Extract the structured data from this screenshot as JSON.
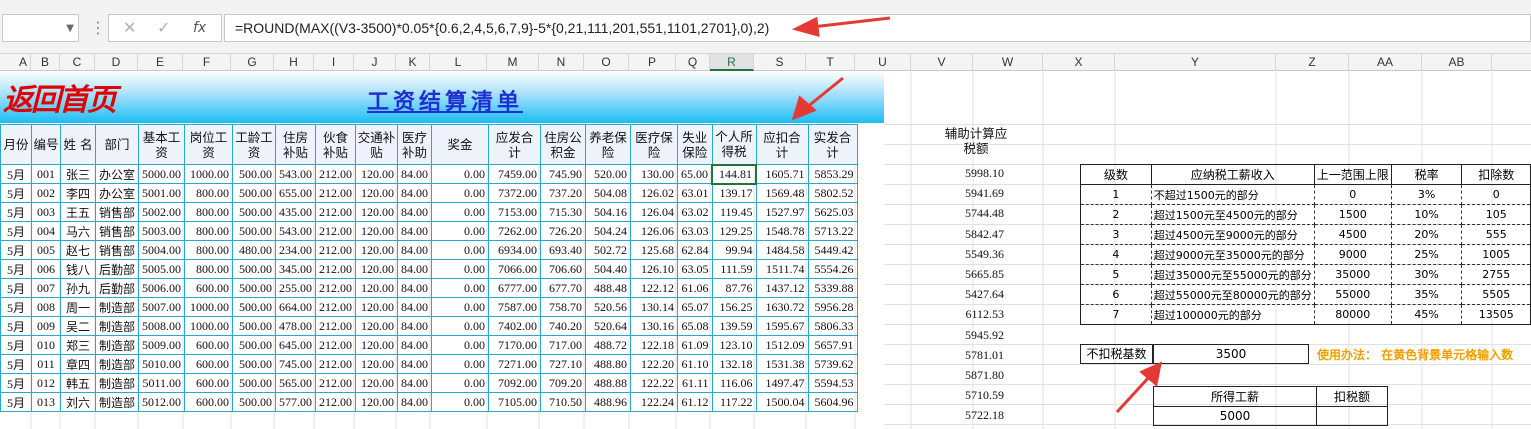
{
  "formula_bar": {
    "cell_ref": "",
    "cancel_icon": "✕",
    "confirm_icon": "✓",
    "fx_label": "fx",
    "formula": "=ROUND(MAX((V3-3500)*0.05*{0.6,2,4,5,6,7,9}-5*{0,21,111,201,551,1101,2701},0),2)"
  },
  "columns": [
    "A",
    "B",
    "C",
    "D",
    "E",
    "F",
    "G",
    "H",
    "I",
    "J",
    "K",
    "L",
    "M",
    "N",
    "O",
    "P",
    "Q",
    "R",
    "S",
    "T",
    "U",
    "V",
    "W",
    "X",
    "Y",
    "Z",
    "AA",
    "AB"
  ],
  "selected_column": "R",
  "banner": {
    "home_link": "返回首页",
    "title": "工资结算清单"
  },
  "table": {
    "headers": [
      "月份",
      "编号",
      "姓 名",
      "部门",
      "基本工资",
      "岗位工资",
      "工龄工资",
      "住房补贴",
      "伙食补贴",
      "交通补贴",
      "医疗补助",
      "奖金",
      "应发合计",
      "住房公积金",
      "养老保险",
      "医疗保险",
      "失业保险",
      "个人所得税",
      "应扣合计",
      "实发合计"
    ],
    "rows": [
      [
        "5月",
        "001",
        "张三",
        "办公室",
        "5000.00",
        "1000.00",
        "500.00",
        "543.00",
        "212.00",
        "120.00",
        "84.00",
        "0.00",
        "7459.00",
        "745.90",
        "520.00",
        "130.00",
        "65.00",
        "144.81",
        "1605.71",
        "5853.29"
      ],
      [
        "5月",
        "002",
        "李四",
        "办公室",
        "5001.00",
        "800.00",
        "500.00",
        "655.00",
        "212.00",
        "120.00",
        "84.00",
        "0.00",
        "7372.00",
        "737.20",
        "504.08",
        "126.02",
        "63.01",
        "139.17",
        "1569.48",
        "5802.52"
      ],
      [
        "5月",
        "003",
        "王五",
        "销售部",
        "5002.00",
        "800.00",
        "500.00",
        "435.00",
        "212.00",
        "120.00",
        "84.00",
        "0.00",
        "7153.00",
        "715.30",
        "504.16",
        "126.04",
        "63.02",
        "119.45",
        "1527.97",
        "5625.03"
      ],
      [
        "5月",
        "004",
        "马六",
        "销售部",
        "5003.00",
        "800.00",
        "500.00",
        "543.00",
        "212.00",
        "120.00",
        "84.00",
        "0.00",
        "7262.00",
        "726.20",
        "504.24",
        "126.06",
        "63.03",
        "129.25",
        "1548.78",
        "5713.22"
      ],
      [
        "5月",
        "005",
        "赵七",
        "销售部",
        "5004.00",
        "800.00",
        "480.00",
        "234.00",
        "212.00",
        "120.00",
        "84.00",
        "0.00",
        "6934.00",
        "693.40",
        "502.72",
        "125.68",
        "62.84",
        "99.94",
        "1484.58",
        "5449.42"
      ],
      [
        "5月",
        "006",
        "钱八",
        "后勤部",
        "5005.00",
        "800.00",
        "500.00",
        "345.00",
        "212.00",
        "120.00",
        "84.00",
        "0.00",
        "7066.00",
        "706.60",
        "504.40",
        "126.10",
        "63.05",
        "111.59",
        "1511.74",
        "5554.26"
      ],
      [
        "5月",
        "007",
        "孙九",
        "后勤部",
        "5006.00",
        "600.00",
        "500.00",
        "255.00",
        "212.00",
        "120.00",
        "84.00",
        "0.00",
        "6777.00",
        "677.70",
        "488.48",
        "122.12",
        "61.06",
        "87.76",
        "1437.12",
        "5339.88"
      ],
      [
        "5月",
        "008",
        "周一",
        "制造部",
        "5007.00",
        "1000.00",
        "500.00",
        "664.00",
        "212.00",
        "120.00",
        "84.00",
        "0.00",
        "7587.00",
        "758.70",
        "520.56",
        "130.14",
        "65.07",
        "156.25",
        "1630.72",
        "5956.28"
      ],
      [
        "5月",
        "009",
        "吴二",
        "制造部",
        "5008.00",
        "1000.00",
        "500.00",
        "478.00",
        "212.00",
        "120.00",
        "84.00",
        "0.00",
        "7402.00",
        "740.20",
        "520.64",
        "130.16",
        "65.08",
        "139.59",
        "1595.67",
        "5806.33"
      ],
      [
        "5月",
        "010",
        "郑三",
        "制造部",
        "5009.00",
        "600.00",
        "500.00",
        "645.00",
        "212.00",
        "120.00",
        "84.00",
        "0.00",
        "7170.00",
        "717.00",
        "488.72",
        "122.18",
        "61.09",
        "123.10",
        "1512.09",
        "5657.91"
      ],
      [
        "5月",
        "011",
        "章四",
        "制造部",
        "5010.00",
        "600.00",
        "500.00",
        "745.00",
        "212.00",
        "120.00",
        "84.00",
        "0.00",
        "7271.00",
        "727.10",
        "488.80",
        "122.20",
        "61.10",
        "132.18",
        "1531.38",
        "5739.62"
      ],
      [
        "5月",
        "012",
        "韩五",
        "制造部",
        "5011.00",
        "600.00",
        "500.00",
        "565.00",
        "212.00",
        "120.00",
        "84.00",
        "0.00",
        "7092.00",
        "709.20",
        "488.88",
        "122.22",
        "61.11",
        "116.06",
        "1497.47",
        "5594.53"
      ],
      [
        "5月",
        "013",
        "刘六",
        "制造部",
        "5012.00",
        "600.00",
        "500.00",
        "577.00",
        "212.00",
        "120.00",
        "84.00",
        "0.00",
        "7105.00",
        "710.50",
        "488.96",
        "122.24",
        "61.12",
        "117.22",
        "1500.04",
        "5604.96"
      ]
    ]
  },
  "aux": {
    "header": "辅助计算应税额",
    "values": [
      "5998.10",
      "5941.69",
      "5744.48",
      "5842.47",
      "5549.36",
      "5665.85",
      "5427.64",
      "6112.53",
      "5945.92",
      "5781.01",
      "5871.80",
      "5710.59",
      "5722.18"
    ]
  },
  "tax_table": {
    "headers": [
      "级数",
      "应纳税工薪收入",
      "上一范围上限",
      "税率",
      "扣除数"
    ],
    "rows": [
      [
        "1",
        "不超过1500元的部分",
        "0",
        "3%",
        "0"
      ],
      [
        "2",
        "超过1500元至4500元的部分",
        "1500",
        "10%",
        "105"
      ],
      [
        "3",
        "超过4500元至9000元的部分",
        "4500",
        "20%",
        "555"
      ],
      [
        "4",
        "超过9000元至35000元的部分",
        "9000",
        "25%",
        "1005"
      ],
      [
        "5",
        "超过35000元至55000元的部分",
        "35000",
        "30%",
        "2755"
      ],
      [
        "6",
        "超过55000元至80000元的部分",
        "55000",
        "35%",
        "5505"
      ],
      [
        "7",
        "超过100000元的部分",
        "80000",
        "45%",
        "13505"
      ]
    ]
  },
  "deduction": {
    "label": "不扣税基数",
    "value": "3500",
    "usage": "使用办法：   在黄色背景单元格输入数"
  },
  "calc": {
    "header_income": "所得工薪",
    "header_tax": "扣税额",
    "income": "5000",
    "tax": ""
  },
  "colors": {
    "accent_green": "#217346",
    "banner_blue": "#1dbef4",
    "table_border": "#29a9c9",
    "arrow_red": "#e53935",
    "usage_orange": "#f0a000"
  }
}
